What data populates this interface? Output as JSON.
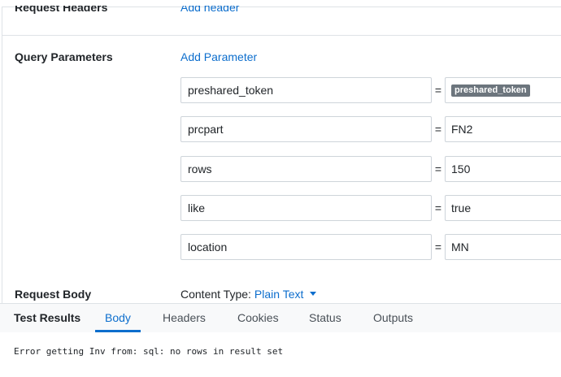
{
  "request_headers": {
    "label": "Request Headers",
    "add_label": "Add header"
  },
  "query_parameters": {
    "label": "Query Parameters",
    "add_label": "Add Parameter",
    "params": [
      {
        "key": "preshared_token",
        "value": "preshared_token",
        "value_is_token": true
      },
      {
        "key": "prcpart",
        "value": "FN2"
      },
      {
        "key": "rows",
        "value": "150"
      },
      {
        "key": "like",
        "value": "true"
      },
      {
        "key": "location",
        "value": "MN"
      }
    ],
    "equals": "="
  },
  "request_body": {
    "label": "Request Body",
    "content_type_label": "Content Type:",
    "content_type_value": "Plain Text"
  },
  "test_results": {
    "title": "Test Results",
    "tabs": [
      "Body",
      "Headers",
      "Cookies",
      "Status",
      "Outputs"
    ],
    "active_tab": "Body",
    "body_text": "Error getting Inv from: sql: no rows in result set"
  },
  "colors": {
    "link": "#0d6ecd",
    "chip_bg": "#6c757d",
    "border": "#ced4da"
  }
}
